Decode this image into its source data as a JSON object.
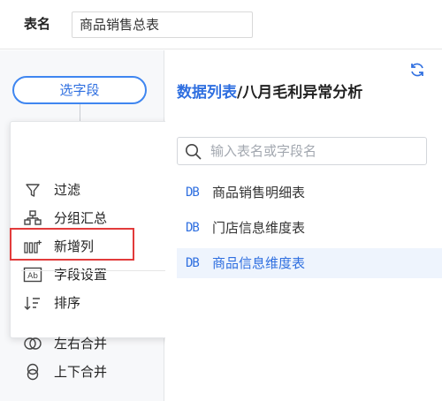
{
  "header": {
    "table_name_label": "表名",
    "table_name_value": "商品销售总表"
  },
  "flow": {
    "select_field_label": "选字段",
    "add_symbol": "+"
  },
  "menu": {
    "items": [
      {
        "label": "过滤",
        "icon": "filter-icon"
      },
      {
        "label": "分组汇总",
        "icon": "group-summary-icon"
      },
      {
        "label": "新增列",
        "icon": "add-column-icon"
      },
      {
        "label": "字段设置",
        "icon": "field-settings-icon"
      },
      {
        "label": "排序",
        "icon": "sort-icon"
      },
      {
        "label": "左右合并",
        "icon": "merge-horizontal-icon"
      },
      {
        "label": "上下合并",
        "icon": "merge-vertical-icon"
      }
    ]
  },
  "data_panel": {
    "title_accent": "数据列表",
    "title_rest": "/八月毛利异常分析",
    "search_placeholder": "输入表名或字段名",
    "db_badge": "DB",
    "tables": [
      {
        "label": "商品销售明细表",
        "selected": false
      },
      {
        "label": "门店信息维度表",
        "selected": false
      },
      {
        "label": "商品信息维度表",
        "selected": true
      }
    ]
  },
  "colors": {
    "accent": "#2f6fe0",
    "add_bar": "#3d88f2",
    "highlight": "#e23b3b"
  }
}
